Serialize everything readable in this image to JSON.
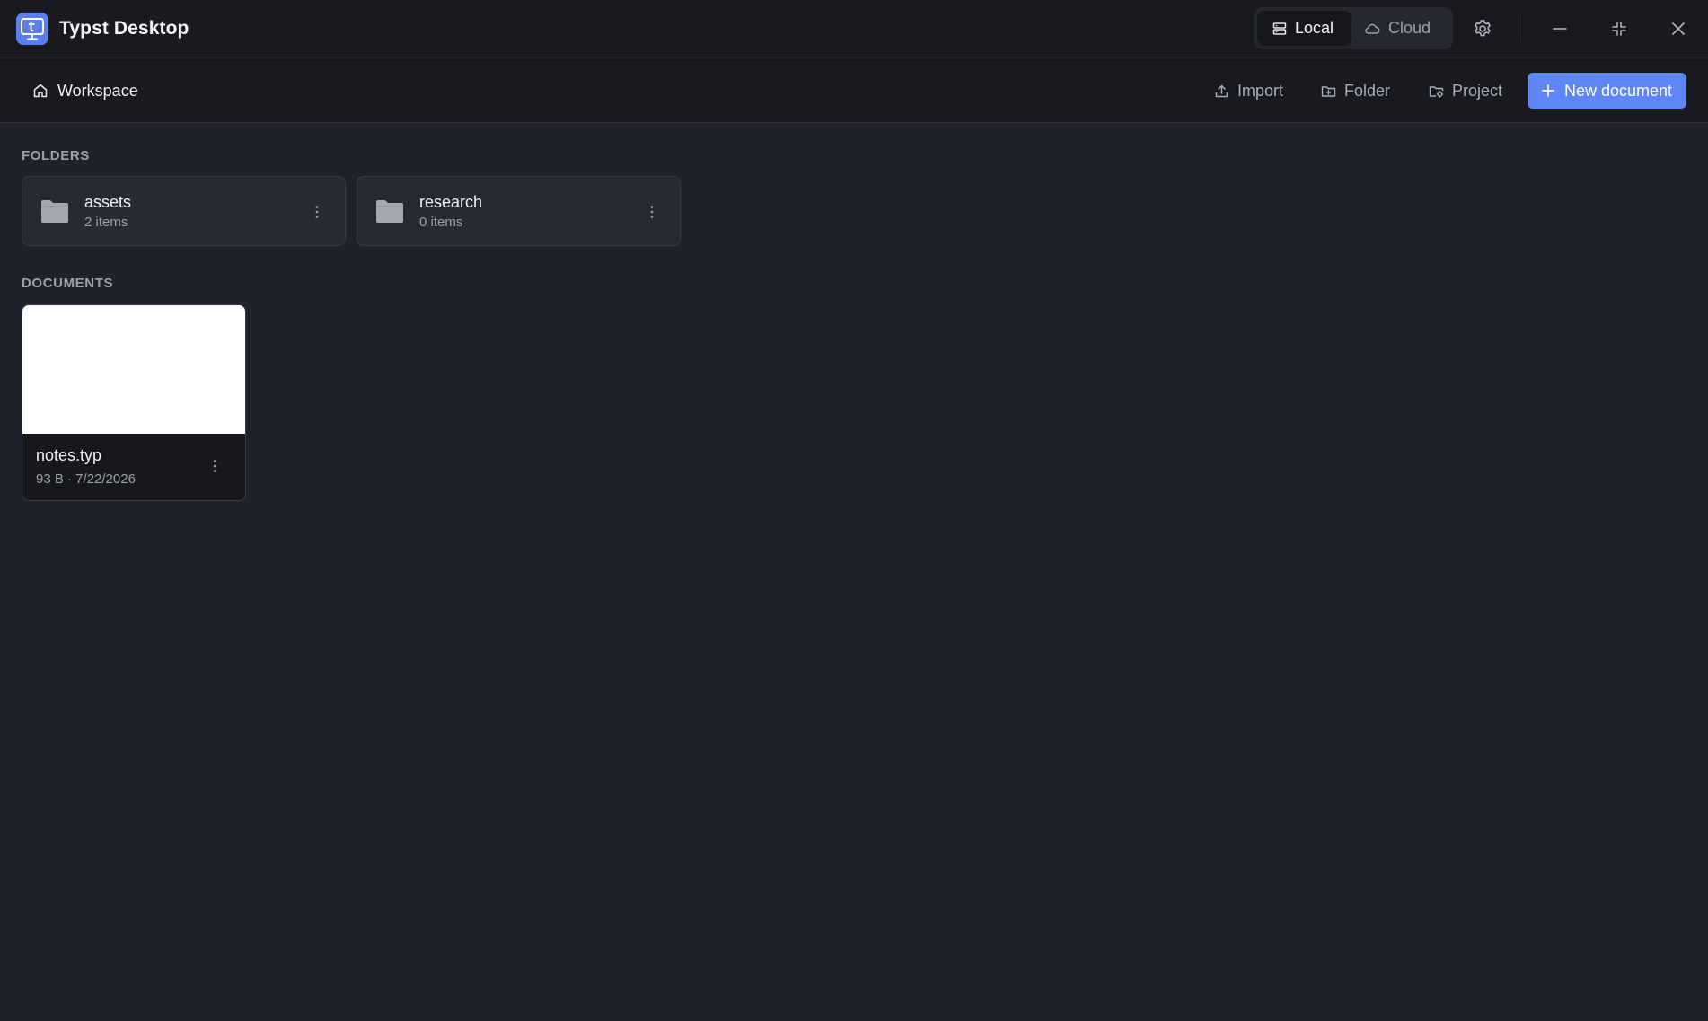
{
  "app": {
    "title": "Typst Desktop",
    "logo_icon": "typst-monitor-logo-icon"
  },
  "titlebar": {
    "storage_toggle": {
      "options": [
        {
          "label": "Local",
          "icon": "server-icon",
          "selected": true
        },
        {
          "label": "Cloud",
          "icon": "cloud-icon",
          "selected": false
        }
      ]
    },
    "buttons": [
      "settings-gear-icon",
      "minimize-icon",
      "restore-icon",
      "close-icon"
    ]
  },
  "toolbar": {
    "breadcrumb": {
      "label": "Workspace",
      "icon": "home-icon"
    },
    "actions": [
      {
        "label": "Import",
        "icon": "upload-icon"
      },
      {
        "label": "Folder",
        "icon": "folder-plus-icon"
      },
      {
        "label": "Project",
        "icon": "folder-cog-icon"
      }
    ],
    "primary": {
      "label": "New document",
      "icon": "plus-icon"
    }
  },
  "folders": {
    "heading": "FOLDERS",
    "items": [
      {
        "name": "assets",
        "meta": "2 items"
      },
      {
        "name": "research",
        "meta": "0 items"
      }
    ]
  },
  "documents": {
    "heading": "DOCUMENTS",
    "items": [
      {
        "name": "notes.typ",
        "meta": "93 B · 7/22/2026"
      }
    ]
  },
  "colors": {
    "background": "#1f222a",
    "chrome": "#181a1f",
    "accent": "#5f86f5",
    "logo": "#5b80ee"
  }
}
